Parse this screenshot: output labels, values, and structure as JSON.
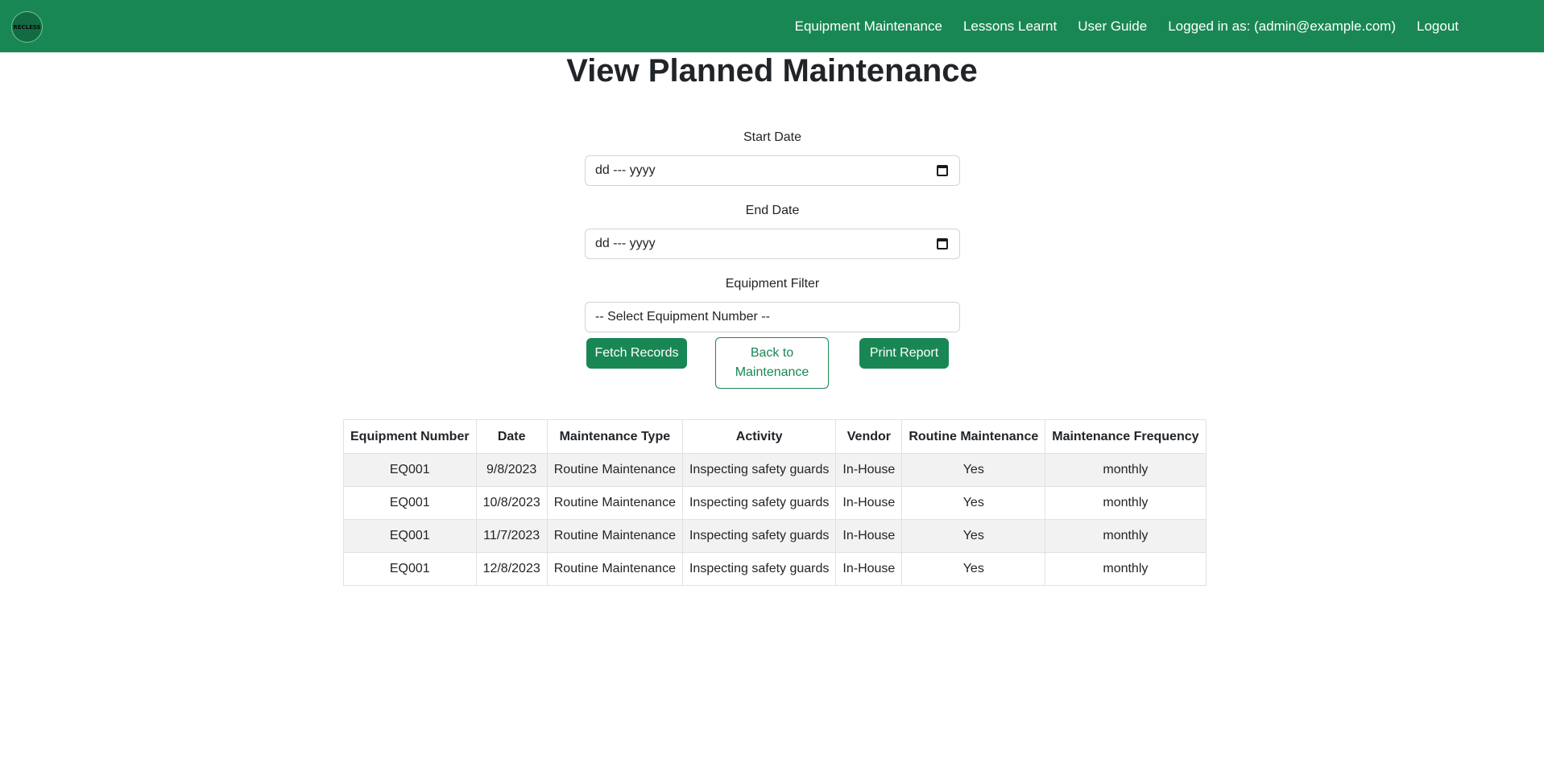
{
  "nav": {
    "logo_text": "RECLESS",
    "links": [
      "Equipment Maintenance",
      "Lessons Learnt",
      "User Guide"
    ],
    "logged_in": "Logged in as: (admin@example.com)",
    "logout": "Logout"
  },
  "page": {
    "title": "View Planned Maintenance"
  },
  "form": {
    "start_label": "Start Date",
    "start_value": "dd --- yyyy",
    "end_label": "End Date",
    "end_value": "dd --- yyyy",
    "equipment_label": "Equipment Filter",
    "equipment_value": "-- Select Equipment Number --"
  },
  "buttons": {
    "fetch": "Fetch Records",
    "back_line1": "Back to",
    "back_line2": "Maintenance",
    "print": "Print Report"
  },
  "table": {
    "headers": [
      "Equipment Number",
      "Date",
      "Maintenance Type",
      "Activity",
      "Vendor",
      "Routine Maintenance",
      "Maintenance Frequency"
    ],
    "rows": [
      [
        "EQ001",
        "9/8/2023",
        "Routine Maintenance",
        "Inspecting safety guards",
        "In-House",
        "Yes",
        "monthly"
      ],
      [
        "EQ001",
        "10/8/2023",
        "Routine Maintenance",
        "Inspecting safety guards",
        "In-House",
        "Yes",
        "monthly"
      ],
      [
        "EQ001",
        "11/7/2023",
        "Routine Maintenance",
        "Inspecting safety guards",
        "In-House",
        "Yes",
        "monthly"
      ],
      [
        "EQ001",
        "12/8/2023",
        "Routine Maintenance",
        "Inspecting safety guards",
        "In-House",
        "Yes",
        "monthly"
      ]
    ]
  },
  "colors": {
    "brand_green": "#198754",
    "row_stripe": "#f2f2f2"
  }
}
